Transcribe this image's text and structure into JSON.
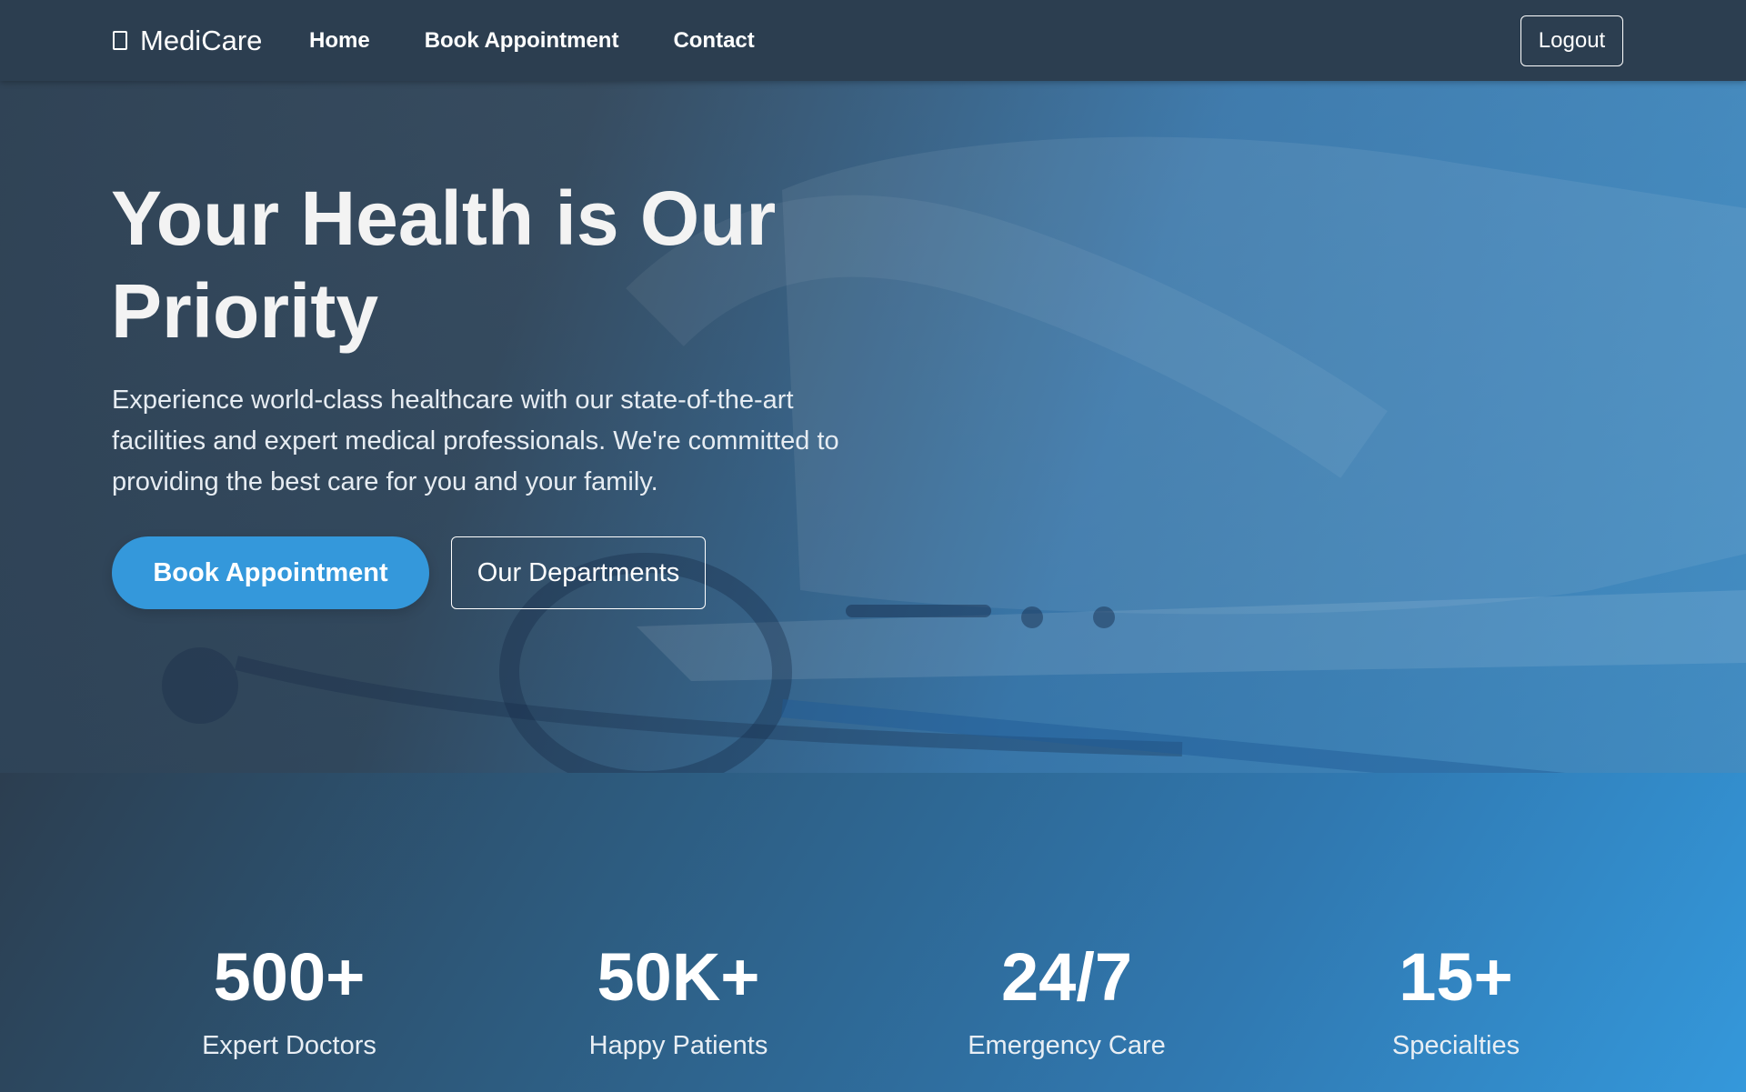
{
  "nav": {
    "brand": "MediCare",
    "brand_icon": "hospital-icon",
    "links": [
      "Home",
      "Book Appointment",
      "Contact"
    ],
    "logout_label": "Logout"
  },
  "hero": {
    "title": "Your Health is Our Priority",
    "subtitle": "Experience world-class healthcare with our state-of-the-art facilities and expert medical professionals. We're committed to providing the best care for you and your family.",
    "primary_button": "Book Appointment",
    "secondary_button": "Our Departments"
  },
  "stats": [
    {
      "value": "500+",
      "label": "Expert Doctors"
    },
    {
      "value": "50K+",
      "label": "Happy Patients"
    },
    {
      "value": "24/7",
      "label": "Emergency Care"
    },
    {
      "value": "15+",
      "label": "Specialties"
    }
  ],
  "colors": {
    "nav_bg": "#2c3e50",
    "accent": "#3498db",
    "text": "#ffffff"
  }
}
